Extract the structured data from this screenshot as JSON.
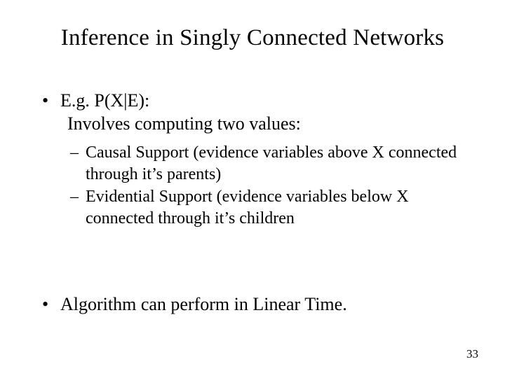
{
  "title": "Inference in Singly Connected Networks",
  "bullets": [
    {
      "text": "E.g. P(X|E):",
      "line2": "Involves computing two values:",
      "sub": [
        "Causal Support (evidence variables above X connected through it’s parents)",
        "Evidential Support (evidence variables below X connected through it’s children"
      ]
    },
    {
      "text": "Algorithm can perform in Linear Time."
    }
  ],
  "page_number": "33",
  "glyphs": {
    "bullet": "•",
    "dash": "–"
  }
}
